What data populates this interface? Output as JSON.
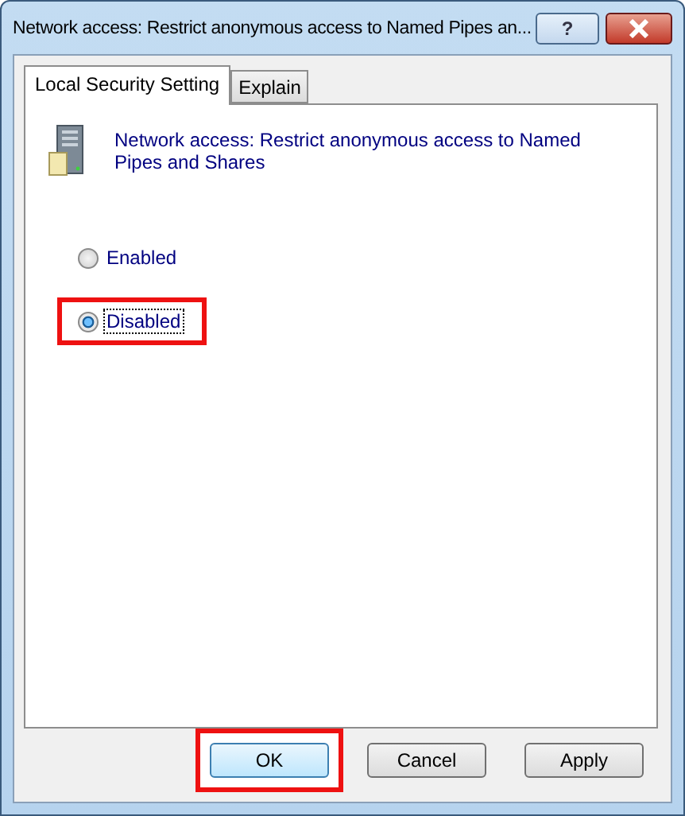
{
  "window": {
    "title": "Network access: Restrict anonymous access to Named Pipes an...",
    "controls": [
      {
        "kind": "help",
        "label": "?"
      },
      {
        "kind": "close"
      }
    ]
  },
  "tabs": [
    {
      "label": "Local Security Setting",
      "selected": true
    },
    {
      "label": "Explain",
      "selected": false
    }
  ],
  "policy": {
    "name": "Network access: Restrict anonymous access to Named Pipes and Shares"
  },
  "options": [
    {
      "label": "Enabled",
      "selected": false,
      "highlighted": false
    },
    {
      "label": "Disabled",
      "selected": true,
      "highlighted": true
    }
  ],
  "buttons": [
    {
      "label": "OK",
      "default": true,
      "highlighted": true
    },
    {
      "label": "Cancel",
      "default": false,
      "highlighted": false
    },
    {
      "label": "Apply",
      "default": false,
      "highlighted": false
    }
  ]
}
